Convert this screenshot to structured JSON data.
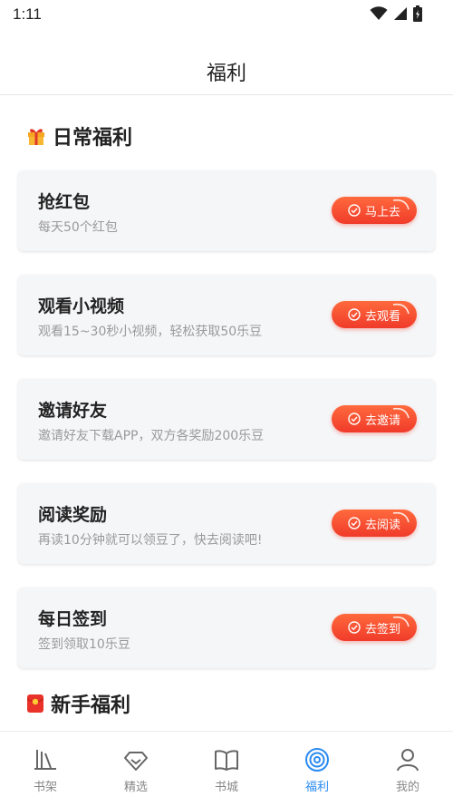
{
  "status_bar": {
    "time": "1:11"
  },
  "header": {
    "title": "福利"
  },
  "sections": {
    "daily": {
      "title": "日常福利",
      "icon": "gift-icon"
    },
    "newbie": {
      "title": "新手福利",
      "icon": "red-envelope-icon"
    }
  },
  "tasks": [
    {
      "title": "抢红包",
      "desc": "每天50个红包",
      "button": "马上去"
    },
    {
      "title": "观看小视频",
      "desc": "观看15~30秒小视频，轻松获取50乐豆",
      "button": "去观看"
    },
    {
      "title": "邀请好友",
      "desc": "邀请好友下载APP，双方各奖励200乐豆",
      "button": "去邀请"
    },
    {
      "title": "阅读奖励",
      "desc": "再读10分钟就可以领豆了，快去阅读吧!",
      "button": "去阅读"
    },
    {
      "title": "每日签到",
      "desc": "签到领取10乐豆",
      "button": "去签到"
    }
  ],
  "tabs": [
    {
      "label": "书架",
      "icon": "bookshelf-icon",
      "active": false
    },
    {
      "label": "精选",
      "icon": "diamond-icon",
      "active": false
    },
    {
      "label": "书城",
      "icon": "open-book-icon",
      "active": false
    },
    {
      "label": "福利",
      "icon": "welfare-target-icon",
      "active": true
    },
    {
      "label": "我的",
      "icon": "user-icon",
      "active": false
    }
  ],
  "colors": {
    "accent": "#2a8af0",
    "button_gradient_start": "#ff6a3d",
    "button_gradient_end": "#f03b2a",
    "card_bg": "#f5f6f8"
  }
}
